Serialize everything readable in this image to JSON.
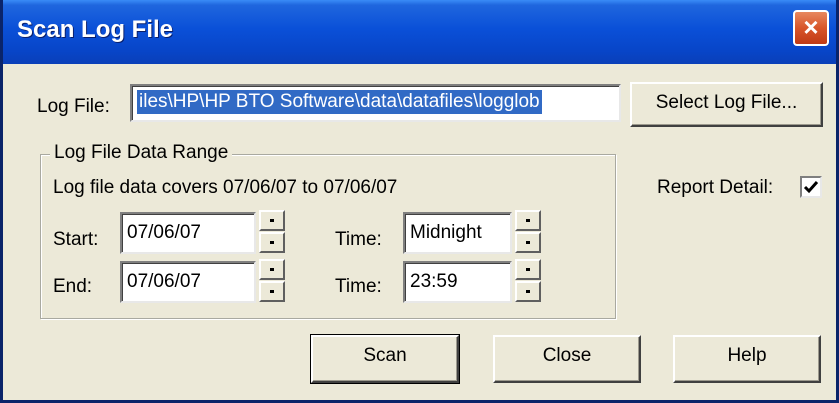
{
  "window": {
    "title": "Scan Log File",
    "close_glyph": "×"
  },
  "log_file": {
    "label": "Log File:",
    "value": "iles\\HP\\HP BTO Software\\data\\datafiles\\logglob",
    "select_button_label": "Select Log File..."
  },
  "report_detail": {
    "label": "Report Detail:",
    "checked": true
  },
  "data_range": {
    "group_title": "Log File Data Range",
    "coverage_text": "Log file data covers 07/06/07 to 07/06/07",
    "start_label": "Start:",
    "start_date": "07/06/07",
    "start_time_label": "Time:",
    "start_time": "Midnight",
    "end_label": "End:",
    "end_date": "07/06/07",
    "end_time_label": "Time:",
    "end_time": "23:59"
  },
  "buttons": {
    "scan": "Scan",
    "close": "Close",
    "help": "Help"
  },
  "icons": {
    "close": "close-icon",
    "check": "checkmark-icon",
    "spin_up": "spin-up-icon",
    "spin_down": "spin-down-icon"
  },
  "colors": {
    "titlebar": "#0a50d8",
    "selection": "#316ac5",
    "dialog_bg": "#ece9d8",
    "close_button": "#d8552a"
  }
}
